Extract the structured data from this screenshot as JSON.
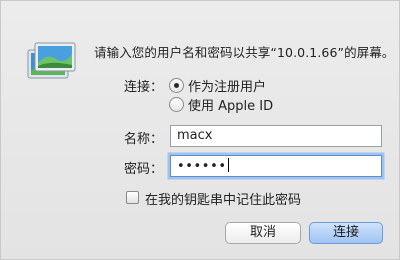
{
  "dialog": {
    "prompt": "请输入您的用户名和密码以共享“10.0.1.66”的屏幕。",
    "connect_label": "连接：",
    "radio_options": [
      {
        "label": "作为注册用户",
        "checked": true
      },
      {
        "label": "使用 Apple ID",
        "checked": false
      }
    ],
    "name_label": "名称：",
    "name_value": "macx",
    "password_label": "密码：",
    "password_value": "••••••",
    "remember_label": "在我的钥匙串中记住此密码",
    "remember_checked": false,
    "cancel_label": "取消",
    "connect_button_label": "连接",
    "icon": "screen-sharing-icon",
    "accent_color": "#5b8fd3"
  }
}
